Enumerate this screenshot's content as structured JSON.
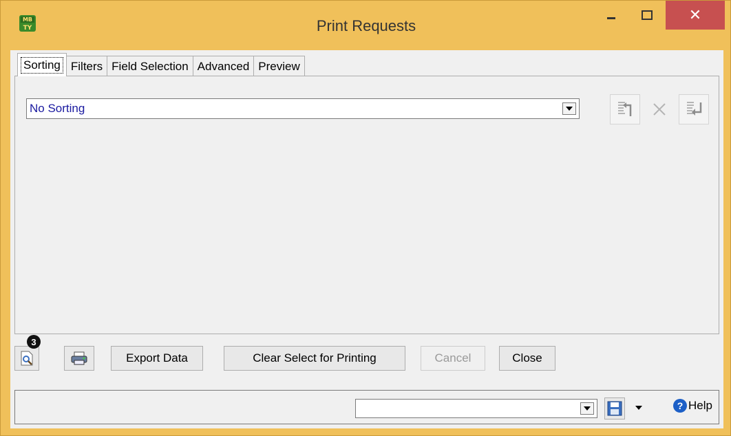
{
  "window": {
    "title": "Print Requests",
    "close_glyph": "✕",
    "minimize_glyph": "–",
    "maximize_glyph": "☐"
  },
  "tabs": [
    {
      "label": "Sorting",
      "active": true
    },
    {
      "label": "Filters"
    },
    {
      "label": "Field Selection"
    },
    {
      "label": "Advanced"
    },
    {
      "label": "Preview"
    }
  ],
  "sorting": {
    "selected": "No Sorting",
    "tools": [
      "insert-before-icon",
      "delete-icon",
      "insert-after-icon"
    ]
  },
  "buttons": {
    "preview_icon": "print-preview-icon",
    "print_icon": "printer-icon",
    "badge": "3",
    "export": "Export Data",
    "clear": "Clear Select for Printing",
    "cancel": "Cancel",
    "close": "Close"
  },
  "statusbar": {
    "combo_value": "",
    "help": "Help"
  },
  "colors": {
    "frame": "#f0c05a",
    "close": "#c75050",
    "link_blue": "#1a1aa0"
  }
}
